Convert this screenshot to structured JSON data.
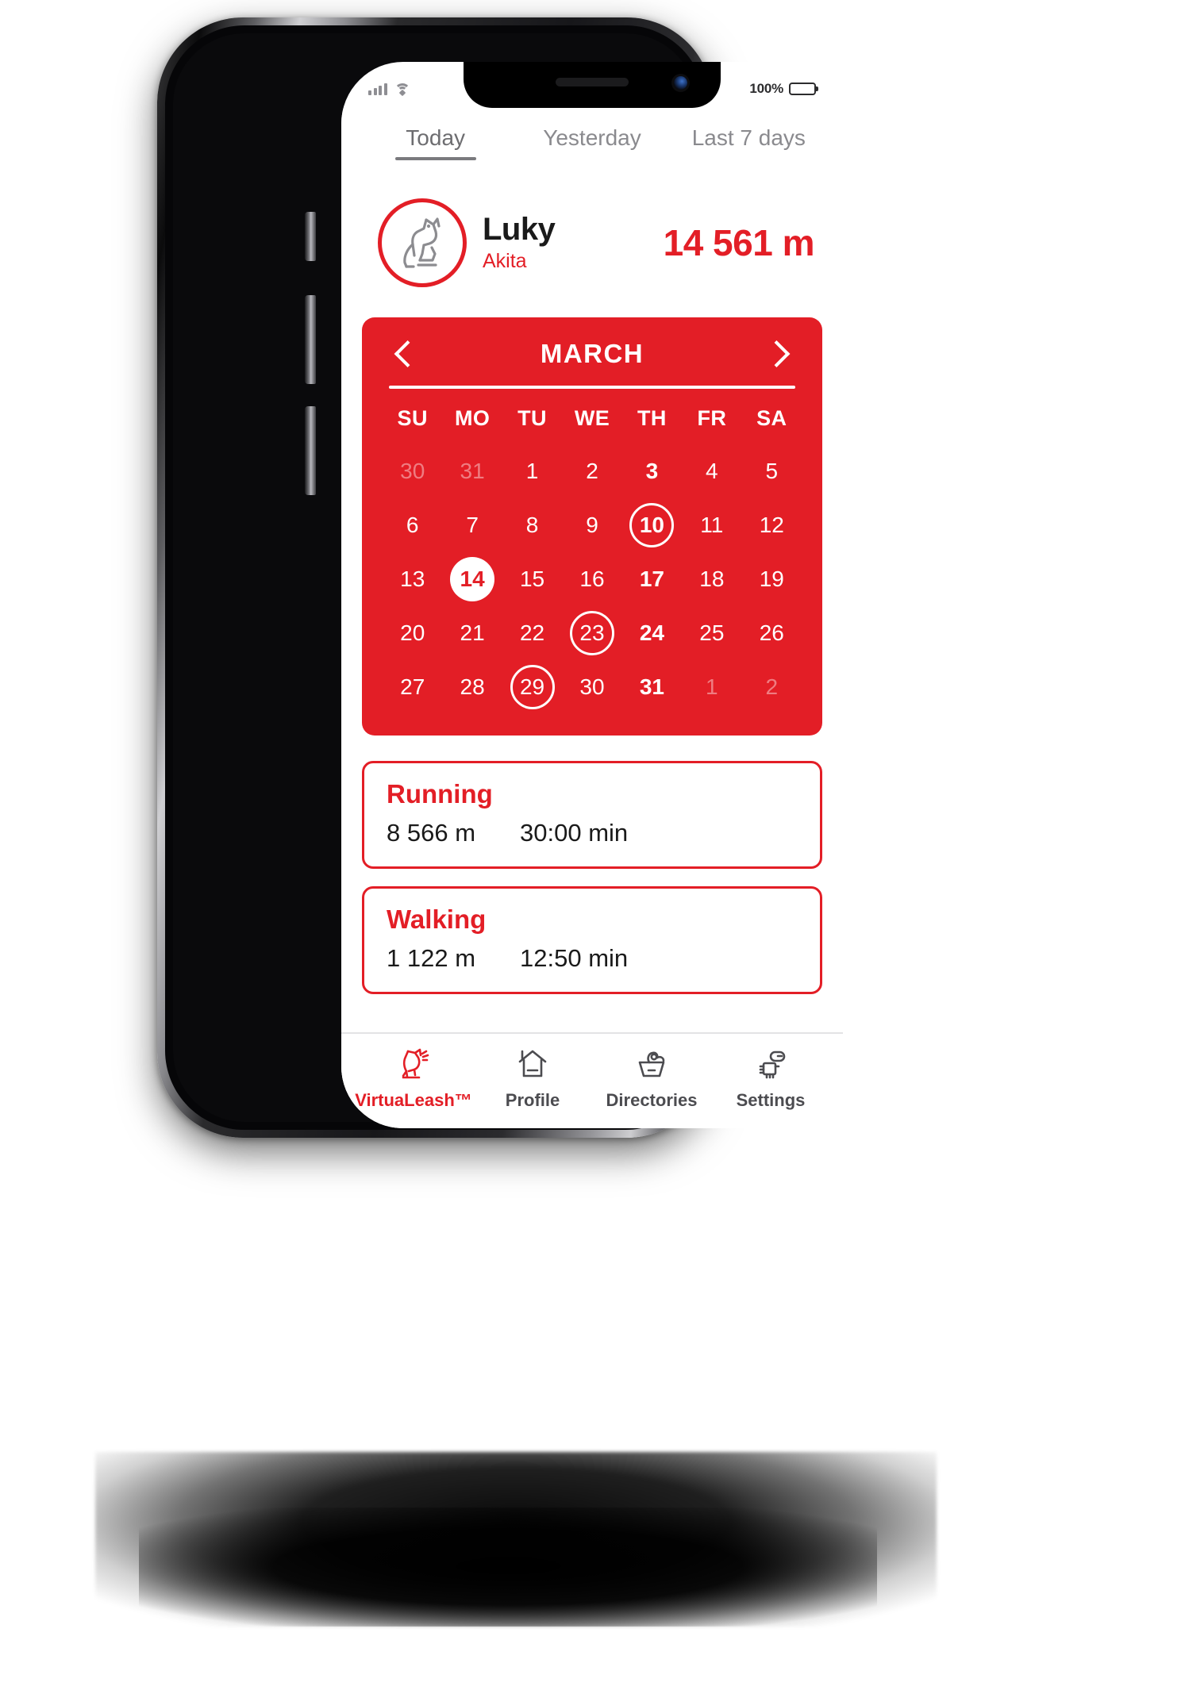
{
  "status_bar": {
    "battery_percent": "100%",
    "signal_icon": "cellular-signal-icon",
    "wifi_icon": "wifi-icon",
    "battery_icon": "battery-icon"
  },
  "tabs": [
    {
      "label": "Today",
      "active": true
    },
    {
      "label": "Yesterday",
      "active": false
    },
    {
      "label": "Last 7 days",
      "active": false
    }
  ],
  "pet": {
    "name": "Luky",
    "breed": "Akita",
    "distance": "14 561 m",
    "avatar_icon": "dog-sitting-icon"
  },
  "calendar": {
    "month": "MARCH",
    "prev_icon": "chevron-left-icon",
    "next_icon": "chevron-right-icon",
    "weekdays": [
      "SU",
      "MO",
      "TU",
      "WE",
      "TH",
      "FR",
      "SA"
    ],
    "days": [
      {
        "n": "30",
        "state": "muted"
      },
      {
        "n": "31",
        "state": "muted"
      },
      {
        "n": "1",
        "state": "normal"
      },
      {
        "n": "2",
        "state": "normal"
      },
      {
        "n": "3",
        "state": "bold"
      },
      {
        "n": "4",
        "state": "normal"
      },
      {
        "n": "5",
        "state": "normal"
      },
      {
        "n": "6",
        "state": "normal"
      },
      {
        "n": "7",
        "state": "normal"
      },
      {
        "n": "8",
        "state": "normal"
      },
      {
        "n": "9",
        "state": "normal"
      },
      {
        "n": "10",
        "state": "ring bold"
      },
      {
        "n": "11",
        "state": "normal"
      },
      {
        "n": "12",
        "state": "normal"
      },
      {
        "n": "13",
        "state": "normal"
      },
      {
        "n": "14",
        "state": "sel"
      },
      {
        "n": "15",
        "state": "normal"
      },
      {
        "n": "16",
        "state": "normal"
      },
      {
        "n": "17",
        "state": "bold"
      },
      {
        "n": "18",
        "state": "normal"
      },
      {
        "n": "19",
        "state": "normal"
      },
      {
        "n": "20",
        "state": "normal"
      },
      {
        "n": "21",
        "state": "normal"
      },
      {
        "n": "22",
        "state": "normal"
      },
      {
        "n": "23",
        "state": "ring"
      },
      {
        "n": "24",
        "state": "bold"
      },
      {
        "n": "25",
        "state": "normal"
      },
      {
        "n": "26",
        "state": "normal"
      },
      {
        "n": "27",
        "state": "normal"
      },
      {
        "n": "28",
        "state": "normal"
      },
      {
        "n": "29",
        "state": "ring"
      },
      {
        "n": "30",
        "state": "normal"
      },
      {
        "n": "31",
        "state": "bold"
      },
      {
        "n": "1",
        "state": "muted"
      },
      {
        "n": "2",
        "state": "muted"
      }
    ]
  },
  "activities": [
    {
      "title": "Running",
      "distance": "8 566 m",
      "duration": "30:00 min"
    },
    {
      "title": "Walking",
      "distance": "1 122 m",
      "duration": "12:50 min"
    }
  ],
  "bottom_nav": [
    {
      "label": "VirtuaLeash™",
      "icon": "dog-icon",
      "active": true
    },
    {
      "label": "Profile",
      "icon": "house-icon",
      "active": false
    },
    {
      "label": "Directories",
      "icon": "food-bowl-icon",
      "active": false
    },
    {
      "label": "Settings",
      "icon": "chip-tag-icon",
      "active": false
    }
  ],
  "colors": {
    "brand_red": "#E31E26",
    "text_dark": "#1a1a1a",
    "text_muted": "#8a8a8e"
  }
}
